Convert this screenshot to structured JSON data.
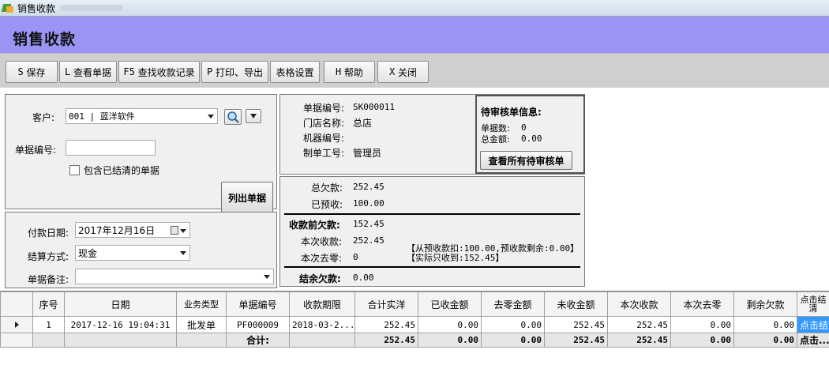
{
  "window": {
    "title": "销售收款"
  },
  "header": {
    "title": "销售收款"
  },
  "toolbar": {
    "save": {
      "key": "S",
      "label": "保存"
    },
    "view": {
      "key": "L",
      "label": "查看单据"
    },
    "find": {
      "key": "F5",
      "label": "查找收款记录"
    },
    "print": {
      "key": "P",
      "label": "打印、导出"
    },
    "table_settings": {
      "label": "表格设置"
    },
    "help": {
      "key": "H",
      "label": "帮助"
    },
    "close": {
      "key": "X",
      "label": "关闭"
    }
  },
  "filter": {
    "customer_label": "客户:",
    "customer_value": "001 | 蓝洋软件",
    "docno_label": "单据编号:",
    "docno_value": "",
    "include_settled_label": "包含已结清的单据",
    "include_settled_checked": false,
    "list_button": "列出单据"
  },
  "payment": {
    "date_label": "付款日期:",
    "date_value": "2017年12月16日",
    "method_label": "结算方式:",
    "method_value": "现金",
    "note_label": "单据备注:",
    "note_value": ""
  },
  "doc_info": {
    "docno_label": "单据编号:",
    "docno_value": "SK000011",
    "store_label": "门店名称:",
    "store_value": "总店",
    "machine_label": "机器编号:",
    "machine_value": "",
    "operator_label": "制单工号:",
    "operator_value": "管理员"
  },
  "pending": {
    "title": "待审核单信息:",
    "count_label": "单据数:",
    "count_value": "0",
    "amount_label": "总金额:",
    "amount_value": "0.00",
    "view_all_button": "查看所有待审核单"
  },
  "summary": {
    "total_debt_label": "总欠款:",
    "total_debt_value": "252.45",
    "prepaid_label": "已预收:",
    "prepaid_value": "100.00",
    "before_label": "收款前欠款:",
    "before_value": "152.45",
    "this_receive_label": "本次收款:",
    "this_receive_value": "252.45",
    "this_zero_label": "本次去零:",
    "this_zero_value": "0",
    "note_line1": "【从预收款扣:100.00,预收款剩余:0.00】",
    "note_line2": "【实际只收到:152.45】",
    "balance_label": "结余欠款:",
    "balance_value": "0.00"
  },
  "grid": {
    "columns": [
      "序号",
      "日期",
      "业务类型",
      "单据编号",
      "收款期限",
      "合计实洋",
      "已收金额",
      "去零金额",
      "未收金额",
      "本次收款",
      "本次去零",
      "剩余欠款",
      "点击结清"
    ],
    "rows": [
      {
        "seq": "1",
        "date": "2017-12-16 19:04:31",
        "type": "批发单",
        "docno": "PF000009",
        "deadline": "2018-03-2...",
        "total": "252.45",
        "received": "0.00",
        "zero": "0.00",
        "unpaid": "252.45",
        "this_receive": "252.45",
        "this_zero": "0.00",
        "remaining": "0.00",
        "action": "点击结清"
      }
    ],
    "sum": {
      "label": "合计:",
      "total": "252.45",
      "received": "0.00",
      "zero": "0.00",
      "unpaid": "252.45",
      "this_receive": "252.45",
      "this_zero": "0.00",
      "remaining": "0.00",
      "action": "点击..."
    }
  },
  "colors": {
    "header_bg": "#9a95f5",
    "toolbar_bg": "#cfcfcf",
    "panel_bg": "#f0f0f0",
    "action_cell_bg": "#3399ff"
  }
}
